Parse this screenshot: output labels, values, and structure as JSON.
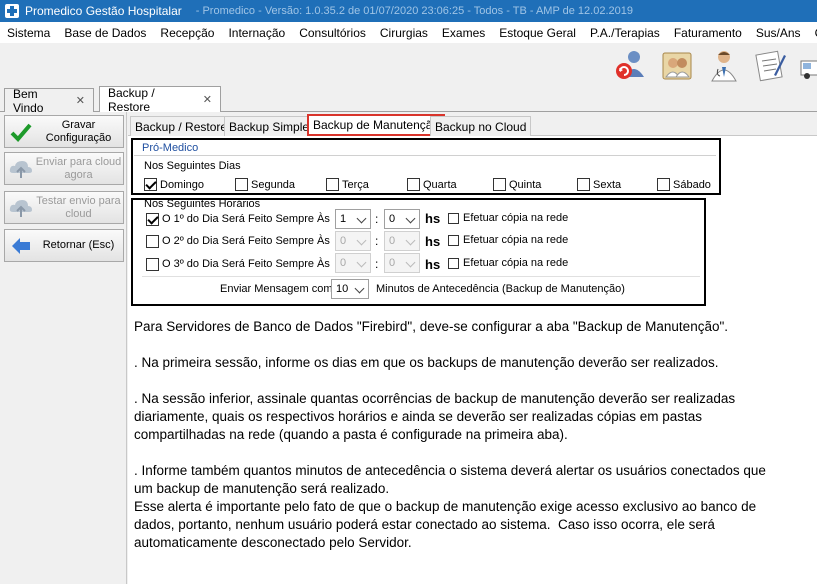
{
  "window": {
    "title": "Promedico Gestão Hospitalar",
    "title_extra": "- Promedico - Versão: 1.0.35.2 de 01/07/2020 23:06:25 - Todos - TB - AMP de 12.02.2019"
  },
  "menu": [
    "Sistema",
    "Base de Dados",
    "Recepção",
    "Internação",
    "Consultórios",
    "Cirurgias",
    "Exames",
    "Estoque Geral",
    "P.A./Terapias",
    "Faturamento",
    "Sus/Ans",
    "Caixa"
  ],
  "toolbar_icons": [
    "refresh-users-icon",
    "doctors-group-icon",
    "doctor-icon",
    "prescription-icon",
    "ambulance-icon"
  ],
  "doc_tabs": [
    {
      "label": "Bem Vindo",
      "close": "✕"
    },
    {
      "label": "Backup / Restore",
      "close": "✕"
    }
  ],
  "left_buttons": {
    "gravar": "Gravar\nConfiguração",
    "enviar": "Enviar para cloud\nagora",
    "testar": "Testar envio para\ncloud",
    "retornar": "Retornar (Esc)"
  },
  "inner_tabs": [
    "Backup / Restore",
    "Backup Simples",
    "Backup de Manutenção",
    "Backup no Cloud"
  ],
  "section_label": "Pró-Medico",
  "dias": {
    "title": "Nos Seguintes Dias",
    "days": [
      {
        "label": "Domingo",
        "checked": true
      },
      {
        "label": "Segunda",
        "checked": false
      },
      {
        "label": "Terça",
        "checked": false
      },
      {
        "label": "Quarta",
        "checked": false
      },
      {
        "label": "Quinta",
        "checked": false
      },
      {
        "label": "Sexta",
        "checked": false
      },
      {
        "label": "Sábado",
        "checked": false
      }
    ]
  },
  "horarios": {
    "title": "Nos Seguintes Horários",
    "rows": [
      {
        "label": "O 1º do Dia Será Feito Sempre Às",
        "checked": true,
        "hour": "1",
        "minute": "0",
        "enabled": true,
        "copia": "Efetuar cópia na rede"
      },
      {
        "label": "O 2º do Dia Será Feito Sempre Às",
        "checked": false,
        "hour": "0",
        "minute": "0",
        "enabled": false,
        "copia": "Efetuar cópia na rede"
      },
      {
        "label": "O 3º do Dia Será Feito Sempre Às",
        "checked": false,
        "hour": "0",
        "minute": "0",
        "enabled": false,
        "copia": "Efetuar cópia na rede"
      }
    ],
    "colon": ":",
    "hs": "hs",
    "mensagem_prefix": "Enviar Mensagem com",
    "mensagem_value": "10",
    "mensagem_suffix": "Minutos de Antecedência (Backup de Manutenção)"
  },
  "description": [
    "Para Servidores de Banco de Dados \"Firebird\", deve-se configurar a aba \"Backup de Manutenção\".",
    "",
    ". Na primeira sessão, informe os dias em que os backups de manutenção deverão ser realizados.",
    "",
    ". Na sessão inferior, assinale quantas ocorrências de backup de manutenção deverão ser realizadas\ndiariamente, quais os respectivos horários e ainda se deverão ser realizadas cópias em pastas\ncompartilhadas na rede (quando a pasta é configurade na primeira aba).",
    "",
    ". Informe também quantos minutos de antecedência o sistema deverá alertar os usuários conectados que\num backup de manutenção será realizado.\nEsse alerta é importante pelo fato de que o backup de manutenção exige acesso exclusivo ao banco de\ndados, portanto, nenhum usuário poderá estar conectado ao sistema.  Caso isso ocorra, ele será\nautomaticamente desconectado pelo Servidor."
  ]
}
